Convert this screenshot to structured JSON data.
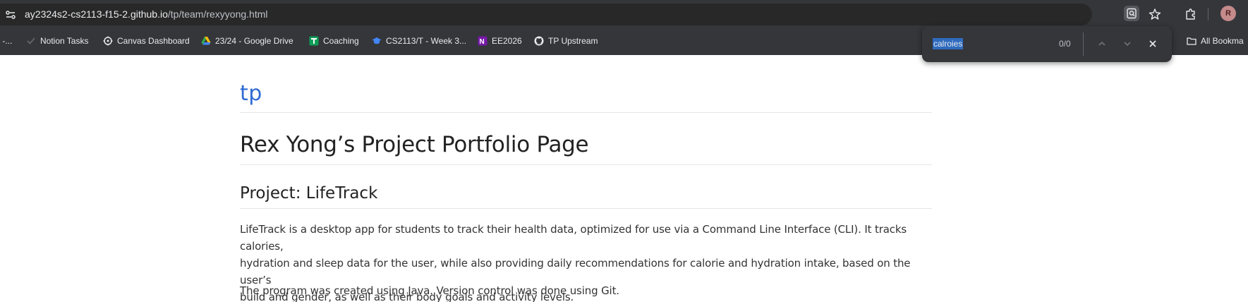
{
  "browser": {
    "url_host": "ay2324s2-cs2113-f15-2.github.io",
    "url_path": "/tp/team/rexyyong.html",
    "avatar_initial": "R"
  },
  "bookmarks": [
    {
      "label": "r -...",
      "icon": "bookmark-overflow-icon"
    },
    {
      "label": "Notion Tasks",
      "icon": "notion-check-icon"
    },
    {
      "label": "Canvas Dashboard",
      "icon": "canvas-icon"
    },
    {
      "label": "23/24 - Google Drive",
      "icon": "google-drive-icon"
    },
    {
      "label": "Coaching",
      "icon": "coaching-icon"
    },
    {
      "label": "CS2113/T - Week 3...",
      "icon": "graduation-cap-icon"
    },
    {
      "label": "EE2026",
      "icon": "onenote-icon"
    },
    {
      "label": "TP Upstream",
      "icon": "github-icon"
    },
    {
      "label": "All Bookma",
      "icon": "folder-icon"
    }
  ],
  "find_bar": {
    "query": "calroies",
    "count": "0/0"
  },
  "page": {
    "site_title": "tp",
    "heading": "Rex Yong’s Project Portfolio Page",
    "subheading": "Project: LifeTrack",
    "paragraph1_line1": "LifeTrack is a desktop app for students to track their health data, optimized for use via a Command Line Interface (CLI). It tracks calories,",
    "paragraph1_line2": "hydration and sleep data for the user, while also providing daily recommendations for calorie and hydration intake, based on the user’s",
    "paragraph1_line3": "build and gender, as well as their body goals and activity levels.",
    "paragraph2": "The program was created using Java. Version control was done using Git."
  },
  "colors": {
    "chrome_bg": "#35363a",
    "address_bar_bg": "#282828",
    "link_blue": "#2e6ad1",
    "find_highlight": "#2f6bbf"
  }
}
